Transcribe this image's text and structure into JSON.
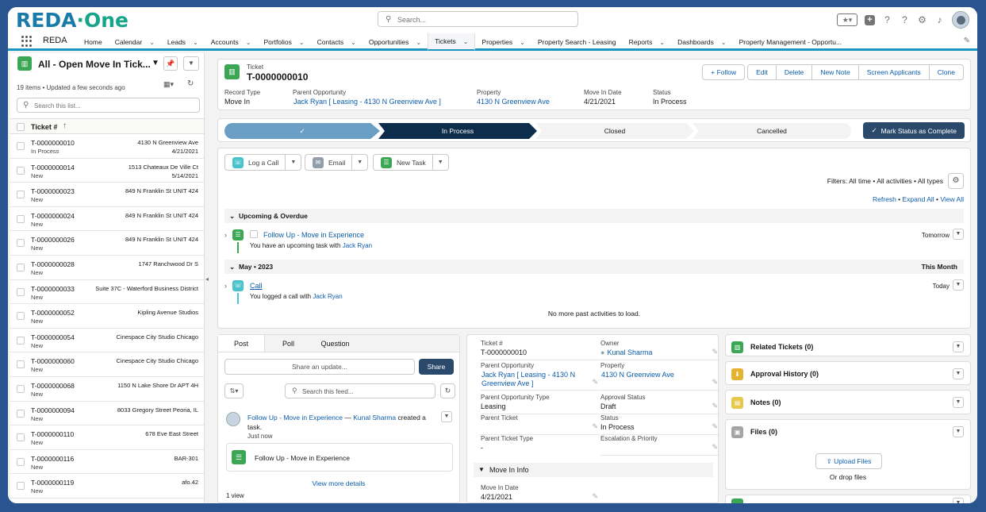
{
  "header": {
    "logo_main": "REDA",
    "logo_dot": "·",
    "logo_suffix": "One",
    "search_placeholder": "Search...",
    "icons": [
      "favorites-icon",
      "add-icon",
      "help-icon",
      "guidance-icon",
      "setup-gear-icon",
      "notifications-bell-icon",
      "user-avatar"
    ]
  },
  "nav": {
    "app_name": "REDA",
    "items": [
      {
        "label": "Home",
        "menu": false
      },
      {
        "label": "Calendar",
        "menu": true
      },
      {
        "label": "Leads",
        "menu": true
      },
      {
        "label": "Accounts",
        "menu": true
      },
      {
        "label": "Portfolios",
        "menu": true
      },
      {
        "label": "Contacts",
        "menu": true
      },
      {
        "label": "Opportunities",
        "menu": true
      },
      {
        "label": "Tickets",
        "menu": true,
        "active": true
      },
      {
        "label": "Properties",
        "menu": true
      },
      {
        "label": "Property Search - Leasing",
        "menu": false
      },
      {
        "label": "Reports",
        "menu": true
      },
      {
        "label": "Dashboards",
        "menu": true
      },
      {
        "label": "Property Management - Opportu...",
        "menu": false
      }
    ]
  },
  "list": {
    "title": "All - Open Move In Tick...",
    "meta": "19 items • Updated a few seconds ago",
    "search_placeholder": "Search this list...",
    "column": "Ticket #",
    "rows": [
      {
        "id": "T-0000000010",
        "status": "In Process",
        "address": "4130 N Greenview Ave",
        "date": "4/21/2021"
      },
      {
        "id": "T-0000000014",
        "status": "New",
        "address": "1513 Chateaux De Ville Ct",
        "date": "5/14/2021"
      },
      {
        "id": "T-0000000023",
        "status": "New",
        "address": "849 N Franklin St UNIT 424",
        "date": ""
      },
      {
        "id": "T-0000000024",
        "status": "New",
        "address": "849 N Franklin St UNIT 424",
        "date": ""
      },
      {
        "id": "T-0000000026",
        "status": "New",
        "address": "849 N Franklin St UNIT 424",
        "date": ""
      },
      {
        "id": "T-0000000028",
        "status": "New",
        "address": "1747 Ranchwood Dr S",
        "date": ""
      },
      {
        "id": "T-0000000033",
        "status": "New",
        "address": "Suite 37C - Waterford Business District",
        "date": ""
      },
      {
        "id": "T-0000000052",
        "status": "New",
        "address": "Kipling Avenue Studios",
        "date": ""
      },
      {
        "id": "T-0000000054",
        "status": "New",
        "address": "Cinespace City Studio Chicago",
        "date": ""
      },
      {
        "id": "T-0000000060",
        "status": "New",
        "address": "Cinespace City Studio Chicago",
        "date": ""
      },
      {
        "id": "T-0000000068",
        "status": "New",
        "address": "1150 N Lake Shore Dr APT 4H",
        "date": ""
      },
      {
        "id": "T-0000000094",
        "status": "New",
        "address": "8033 Gregory Street Peoria, IL",
        "date": ""
      },
      {
        "id": "T-0000000110",
        "status": "New",
        "address": "678 Eve East Street",
        "date": ""
      },
      {
        "id": "T-0000000116",
        "status": "New",
        "address": "BAR-301",
        "date": ""
      },
      {
        "id": "T-0000000119",
        "status": "New",
        "address": "afo.42",
        "date": ""
      }
    ]
  },
  "record": {
    "type_label": "Ticket",
    "name": "T-0000000010",
    "buttons": {
      "follow": "+ Follow",
      "edit": "Edit",
      "delete": "Delete",
      "new_note": "New Note",
      "screen": "Screen Applicants",
      "clone": "Clone"
    },
    "fields": [
      {
        "label": "Record Type",
        "value": "Move In"
      },
      {
        "label": "Parent Opportunity",
        "value": "Jack Ryan [ Leasing - 4130 N Greenview Ave ]"
      },
      {
        "label": "Property",
        "value": "4130 N Greenview Ave"
      },
      {
        "label": "Move In Date",
        "value": "4/21/2021"
      },
      {
        "label": "Status",
        "value": "In Process"
      }
    ]
  },
  "path": {
    "stages": [
      "✓",
      "In Process",
      "Closed",
      "Cancelled"
    ],
    "mark_button": "Mark Status as Complete"
  },
  "activity": {
    "log_call": "Log a Call",
    "email": "Email",
    "new_task": "New Task",
    "filters": "Filters: All time • All activities • All types",
    "refresh": "Refresh",
    "expand_all": "Expand All",
    "view_all": "View All",
    "upcoming_header": "Upcoming & Overdue",
    "task_title": "Follow Up - Move in Experience",
    "task_desc": "You have an upcoming task with",
    "task_who": "Jack Ryan",
    "task_when": "Tomorrow",
    "month_header": "May • 2023",
    "month_right": "This Month",
    "call_title": "Call",
    "call_desc": "You logged a call with",
    "call_who": "Jack Ryan",
    "call_when": "Today",
    "no_more": "No more past activities to load."
  },
  "feed": {
    "tabs": [
      "Post",
      "Poll",
      "Question"
    ],
    "share_placeholder": "Share an update...",
    "share_button": "Share",
    "search_placeholder": "Search this feed...",
    "post_link": "Follow Up - Move in Experience",
    "post_sep": " — ",
    "post_user": "Kunal Sharma",
    "post_suffix": " created a task.",
    "post_when": "Just now",
    "card_title": "Follow Up - Move in Experience",
    "view_more": "View more details",
    "views": "1 view"
  },
  "details": {
    "fields": [
      {
        "label": "Ticket #",
        "value": "T-0000000010"
      },
      {
        "label": "Owner",
        "value": "Kunal Sharma"
      },
      {
        "label": "Parent Opportunity",
        "value": "Jack Ryan [ Leasing - 4130 N Greenview Ave ]"
      },
      {
        "label": "Property",
        "value": "4130 N Greenview Ave"
      },
      {
        "label": "Parent Opportunity Type",
        "value": "Leasing"
      },
      {
        "label": "Approval Status",
        "value": "Draft"
      },
      {
        "label": "Parent Ticket",
        "value": ""
      },
      {
        "label": "Status",
        "value": "In Process"
      },
      {
        "label": "Parent Ticket Type",
        "value": "-"
      },
      {
        "label": "Escalation & Priority",
        "value": ""
      }
    ],
    "section": "Move In Info",
    "move_in_label": "Move In Date",
    "move_in_value": "4/21/2021"
  },
  "related": {
    "tickets": "Related Tickets (0)",
    "approval": "Approval History (0)",
    "notes": "Notes (0)",
    "files": "Files (0)",
    "upload": "Upload Files",
    "drop": "Or drop files"
  },
  "colors": {
    "brand_blue": "#1a7aa8",
    "brand_green": "#17a58a",
    "nav_accent": "#1b96c4",
    "ticket_green": "#3ba755",
    "dark_button": "#2b4a6b",
    "link": "#0b5cab"
  }
}
